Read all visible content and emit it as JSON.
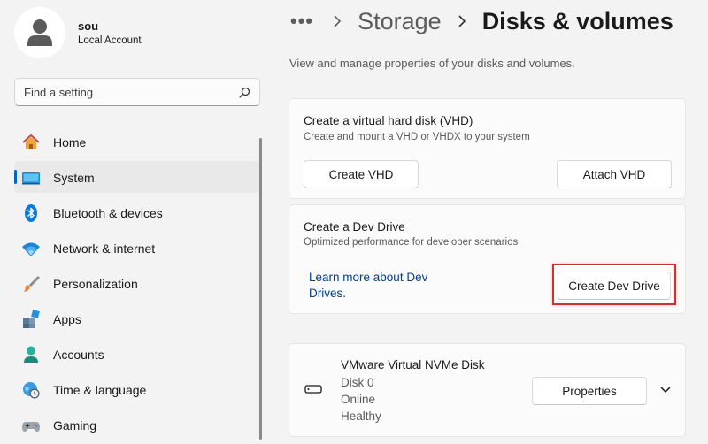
{
  "profile": {
    "name": "sou",
    "account_type": "Local Account"
  },
  "search": {
    "placeholder": "Find a setting"
  },
  "nav": [
    {
      "label": "Home",
      "icon": "home-icon"
    },
    {
      "label": "System",
      "icon": "system-icon",
      "active": true
    },
    {
      "label": "Bluetooth & devices",
      "icon": "bluetooth-icon"
    },
    {
      "label": "Network & internet",
      "icon": "wifi-icon"
    },
    {
      "label": "Personalization",
      "icon": "brush-icon"
    },
    {
      "label": "Apps",
      "icon": "apps-icon"
    },
    {
      "label": "Accounts",
      "icon": "accounts-icon"
    },
    {
      "label": "Time & language",
      "icon": "globe-clock-icon"
    },
    {
      "label": "Gaming",
      "icon": "controller-icon"
    }
  ],
  "breadcrumb": {
    "dots": "•••",
    "parent": "Storage",
    "current": "Disks & volumes"
  },
  "page": {
    "description": "View and manage properties of your disks and volumes."
  },
  "vhd_card": {
    "title": "Create a virtual hard disk (VHD)",
    "subtitle": "Create and mount a VHD or VHDX to your system",
    "create_label": "Create VHD",
    "attach_label": "Attach VHD"
  },
  "dev_card": {
    "title": "Create a Dev Drive",
    "subtitle": "Optimized performance for developer scenarios",
    "link_label": "Learn more about Dev Drives.",
    "create_label": "Create Dev Drive"
  },
  "disk_card": {
    "name": "VMware Virtual NVMe Disk",
    "disk_number": "Disk 0",
    "status": "Online",
    "health": "Healthy",
    "properties_label": "Properties"
  },
  "colors": {
    "accent": "#0067c0",
    "highlight": "#d32f2f",
    "link": "#003e92"
  }
}
